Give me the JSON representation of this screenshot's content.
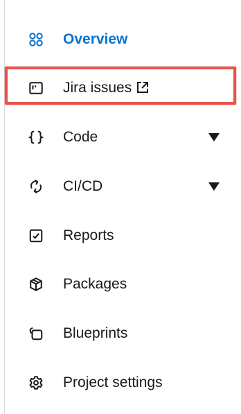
{
  "nav": {
    "items": [
      {
        "label": "Overview",
        "icon": "grid-icon",
        "active": true
      },
      {
        "label": "Jira issues",
        "icon": "board-icon",
        "external": true
      },
      {
        "label": "Code",
        "icon": "braces-icon",
        "expandable": true
      },
      {
        "label": "CI/CD",
        "icon": "refresh-icon",
        "expandable": true
      },
      {
        "label": "Reports",
        "icon": "check-square-icon"
      },
      {
        "label": "Packages",
        "icon": "package-icon"
      },
      {
        "label": "Blueprints",
        "icon": "blueprint-icon"
      },
      {
        "label": "Project settings",
        "icon": "gear-icon"
      }
    ]
  },
  "colors": {
    "active": "#0972d3",
    "text": "#16191f",
    "highlight": "#e8534a"
  }
}
